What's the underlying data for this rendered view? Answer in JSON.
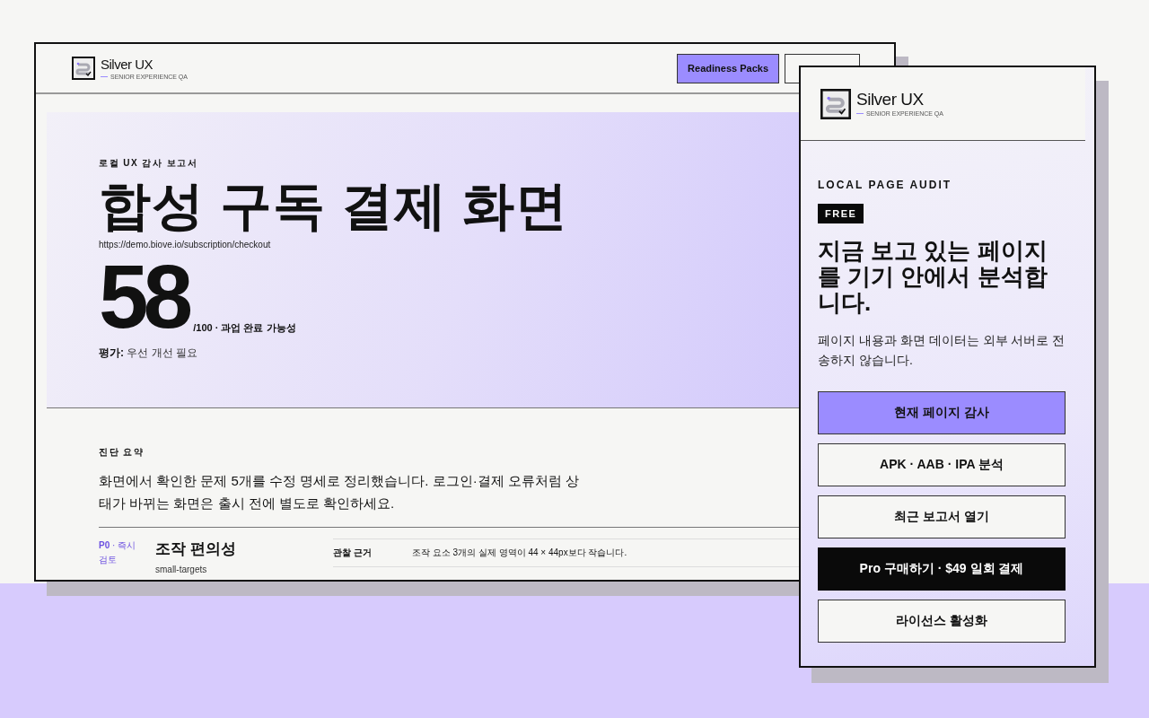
{
  "report": {
    "logo": {
      "name": "Silver UX",
      "tagline": "SENIOR EXPERIENCE QA"
    },
    "header_buttons": [
      {
        "label": "Readiness Packs",
        "kind": "primary"
      },
      {
        "kind": "outline"
      }
    ],
    "hero": {
      "eyebrow": "로컬 UX 감사 보고서",
      "title": "합성 구독 결제 화면",
      "url": "https://demo.biove.io/subscription/checkout",
      "score": "58",
      "score_suffix": "/100 · 과업 완료 가능성",
      "rating": "**평가:** 우선 개선 필요"
    },
    "summary": {
      "eyebrow": "진단 요약",
      "text": "화면에서 확인한 문제 5개를 수정 명세로 정리했습니다. 로그인·결제 오류처럼 상태가 바뀌는 화면은 출시 전에 별도로 확인하세요."
    },
    "findings": [
      {
        "priority": "**P0** · 즉시 검토",
        "title": "조작 편의성",
        "code": "small-targets",
        "rows": [
          {
            "label": "관찰 근거",
            "text": "조작 요소 3개의 실제 영역이 44 × 44px보다 작습니다."
          }
        ]
      }
    ]
  },
  "panel": {
    "logo": {
      "name": "Silver UX",
      "tagline": "SENIOR EXPERIENCE QA"
    },
    "eyebrow": "LOCAL PAGE AUDIT",
    "badge": "FREE",
    "heading": "지금 보고 있는 페이지를 기기 안에서 분석합니다.",
    "text": "페이지 내용과 화면 데이터는 외부 서버로 전송하지 않습니다.",
    "buttons": [
      {
        "label": "현재 페이지 감사",
        "kind": "primary"
      },
      {
        "label": "APK · AAB · IPA 분석",
        "kind": "outline"
      },
      {
        "label": "최근 보고서 열기",
        "kind": "outline"
      },
      {
        "label": "Pro 구매하기 · $49 일회 결제",
        "kind": "dark"
      },
      {
        "label": "라이선스 활성화",
        "kind": "outline"
      }
    ]
  }
}
